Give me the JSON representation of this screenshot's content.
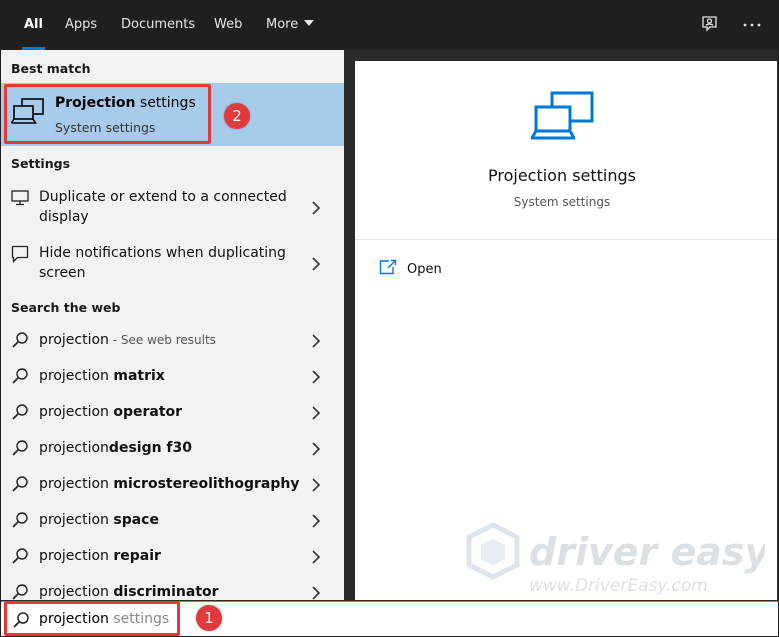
{
  "tabs": [
    {
      "label": "All",
      "active": true
    },
    {
      "label": "Apps"
    },
    {
      "label": "Documents"
    },
    {
      "label": "Web"
    },
    {
      "label": "More"
    }
  ],
  "topbar_icons": [
    "feedback-icon",
    "more-options-icon"
  ],
  "best_match": {
    "heading": "Best match",
    "title_bold": "Projection",
    "title_rest": " settings",
    "subtitle": "System settings",
    "icon": "projection-icon"
  },
  "settings_section": {
    "heading": "Settings",
    "items": [
      {
        "line1": "Duplicate or extend to a connected",
        "line2": "display",
        "icon": "monitor-icon"
      },
      {
        "line1": "Hide notifications when duplicating",
        "line2": "screen",
        "icon": "notification-icon"
      }
    ]
  },
  "web_section": {
    "heading": "Search the web",
    "items": [
      {
        "prefix": "projection",
        "bold": "",
        "hint": " - See web results"
      },
      {
        "prefix": "projection ",
        "bold": "matrix",
        "hint": ""
      },
      {
        "prefix": "projection ",
        "bold": "operator",
        "hint": ""
      },
      {
        "prefix": "projection",
        "bold": "design f30",
        "hint": ""
      },
      {
        "prefix": "projection ",
        "bold": "microstereolithography",
        "hint": ""
      },
      {
        "prefix": "projection ",
        "bold": "space",
        "hint": ""
      },
      {
        "prefix": "projection ",
        "bold": "repair",
        "hint": ""
      },
      {
        "prefix": "projection ",
        "bold": "discriminator",
        "hint": ""
      }
    ]
  },
  "preview": {
    "title": "Projection settings",
    "subtitle": "System settings",
    "open_label": "Open"
  },
  "search": {
    "typed": "projection",
    "autocomplete": " settings"
  },
  "callouts": {
    "one": "1",
    "two": "2"
  },
  "watermark": {
    "brand": "driver easy",
    "url": "www.DriverEasy.com"
  },
  "colors": {
    "accent": "#0078d7",
    "selection": "#a7cbea",
    "callout": "#e0393e",
    "topbar": "#1f1f1f"
  }
}
